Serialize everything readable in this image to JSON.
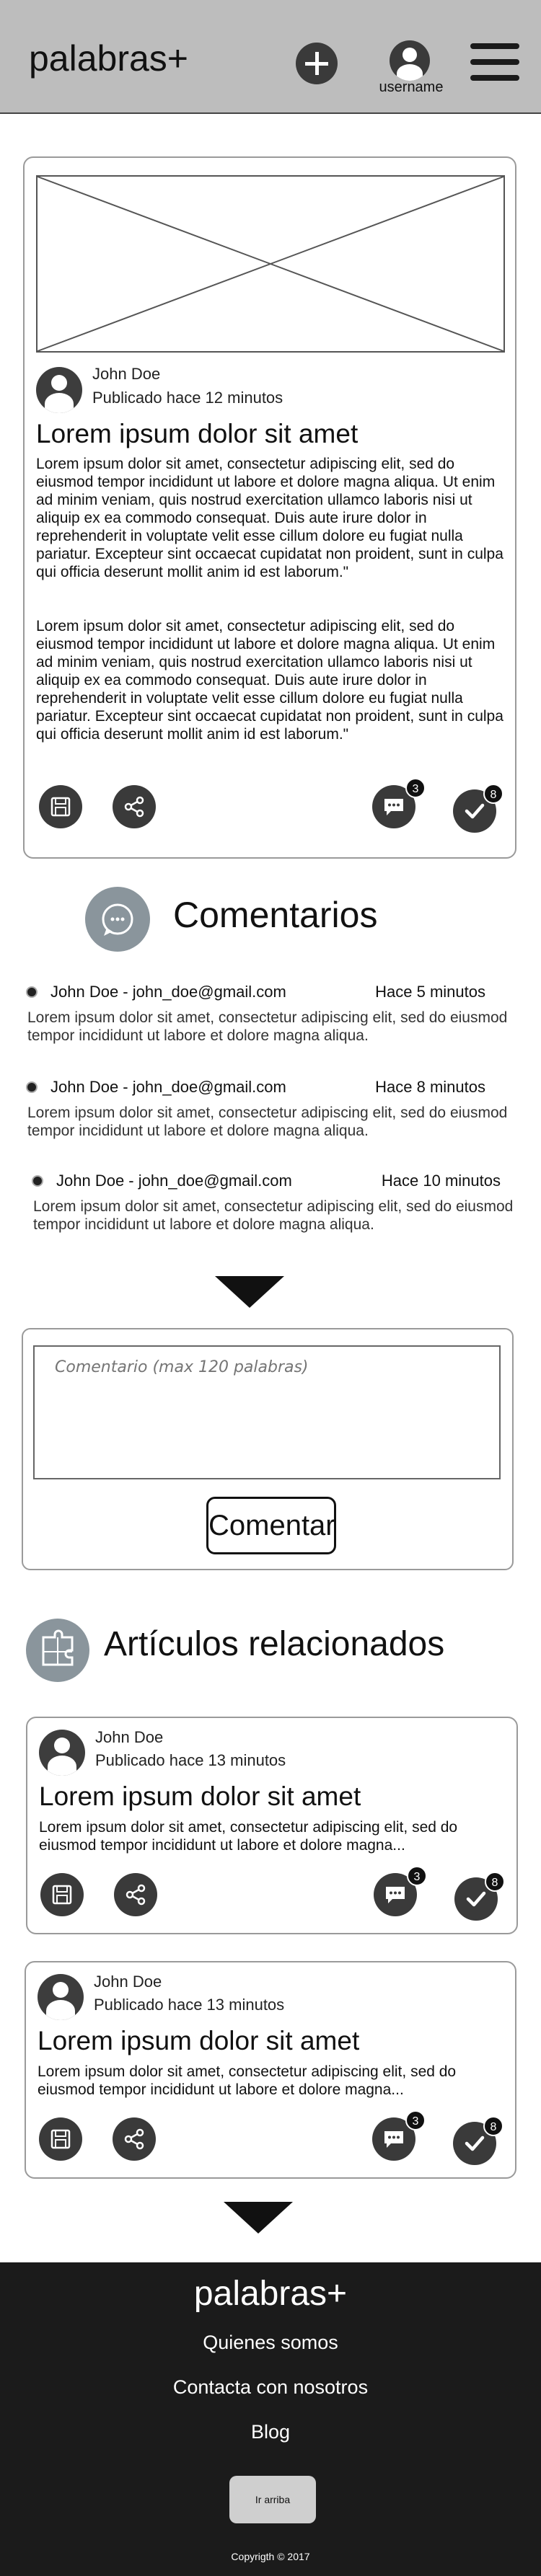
{
  "header": {
    "brand": "palabras+",
    "username": "username"
  },
  "post": {
    "author": "John Doe",
    "published": "Publicado hace 12 minutos",
    "title": "Lorem ipsum dolor sit amet",
    "paragraphs": [
      "Lorem ipsum dolor sit amet, consectetur adipiscing elit, sed do eiusmod tempor incididunt ut labore et dolore magna aliqua. Ut enim ad minim veniam, quis nostrud exercitation ullamco laboris nisi ut aliquip ex ea commodo consequat. Duis aute irure dolor in reprehenderit in voluptate velit esse cillum dolore eu fugiat nulla pariatur. Excepteur sint occaecat cupidatat non proident, sunt in culpa qui officia deserunt mollit anim id est laborum.\"",
      "Lorem ipsum dolor sit amet, consectetur adipiscing elit, sed do eiusmod tempor incididunt ut labore et dolore magna aliqua. Ut enim ad minim veniam, quis nostrud exercitation ullamco laboris nisi ut aliquip ex ea commodo consequat. Duis aute irure dolor in reprehenderit in voluptate velit esse cillum dolore eu fugiat nulla pariatur. Excepteur sint occaecat cupidatat non proident, sunt in culpa qui officia deserunt mollit anim id est laborum.\""
    ],
    "comment_count": "3",
    "approval_count": "8"
  },
  "comments": {
    "title": "Comentarios",
    "items": [
      {
        "author": "John Doe - john_doe@gmail.com",
        "time": "Hace 5 minutos",
        "text": "Lorem ipsum dolor sit amet, consectetur adipiscing elit, sed do eiusmod tempor incididunt ut labore et dolore magna aliqua."
      },
      {
        "author": "John Doe - john_doe@gmail.com",
        "time": "Hace 8 minutos",
        "text": "Lorem ipsum dolor sit amet, consectetur adipiscing elit, sed do eiusmod tempor incididunt ut labore et dolore magna aliqua."
      },
      {
        "author": "John Doe - john_doe@gmail.com",
        "time": "Hace 10 minutos",
        "text": "Lorem ipsum dolor sit amet, consectetur adipiscing elit, sed do eiusmod tempor incididunt ut labore et dolore magna aliqua."
      }
    ]
  },
  "comment_form": {
    "placeholder": "Comentario (max 120 palabras)",
    "submit_label": "Comentar"
  },
  "related": {
    "title": "Artículos relacionados",
    "items": [
      {
        "author": "John Doe",
        "published": "Publicado hace 13 minutos",
        "title": "Lorem ipsum dolor sit amet",
        "excerpt": "Lorem ipsum dolor sit amet, consectetur adipiscing elit, sed do eiusmod tempor incididunt ut labore et dolore magna...",
        "comment_count": "3",
        "approval_count": "8"
      },
      {
        "author": "John Doe",
        "published": "Publicado hace 13 minutos",
        "title": "Lorem ipsum dolor sit amet",
        "excerpt": "Lorem ipsum dolor sit amet, consectetur adipiscing elit, sed do eiusmod tempor incididunt ut labore et dolore magna...",
        "comment_count": "3",
        "approval_count": "8"
      }
    ]
  },
  "footer": {
    "brand": "palabras+",
    "links": [
      "Quienes somos",
      "Contacta con nosotros",
      "Blog"
    ],
    "to_top_label": "Ir arriba",
    "copyright": "Copyrigth © 2017"
  },
  "icons": {
    "add": "plus-icon",
    "user": "user-icon",
    "menu": "hamburger-menu-icon",
    "save": "floppy-disk-icon",
    "share": "share-icon",
    "comment": "speech-bubble-icon",
    "approve": "checkmark-icon",
    "comments_section": "chat-bubble-icon",
    "related_section": "puzzle-icon",
    "more": "down-arrow-icon"
  }
}
